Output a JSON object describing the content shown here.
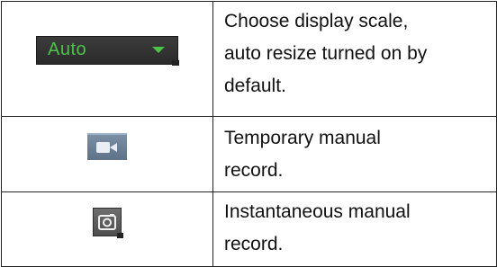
{
  "table": {
    "rows": [
      {
        "icon": "auto-scale-dropdown",
        "control_label": "Auto",
        "description_lines": [
          "Choose display scale,",
          "auto resize turned on by",
          "default."
        ]
      },
      {
        "icon": "video-camera-icon",
        "description_lines": [
          "Temporary manual",
          "record."
        ]
      },
      {
        "icon": "snapshot-icon",
        "description_lines": [
          "Instantaneous manual",
          "record."
        ]
      }
    ]
  },
  "colors": {
    "dropdown_text": "#4ec24a",
    "dropdown_bg": "#2f2f2f",
    "record_button_bg": "#6b8096",
    "snapshot_button_bg": "#5a5a5a",
    "border": "#222222"
  }
}
